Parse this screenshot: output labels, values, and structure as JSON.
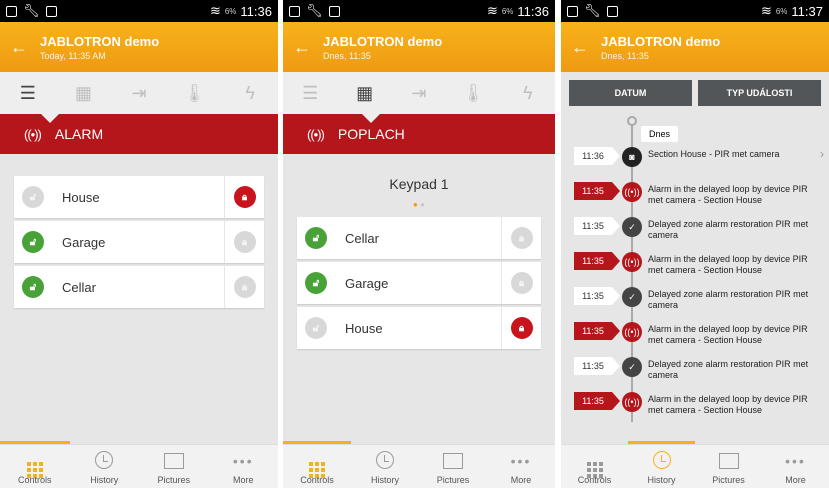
{
  "status": {
    "time1": "11:36",
    "time2": "11:36",
    "time3": "11:37",
    "battery": "6%"
  },
  "app": {
    "title": "JABLOTRON demo",
    "sub1": "Today, 11:35 AM",
    "sub2": "Dnes, 11:35",
    "sub3": "Dnes, 11:35"
  },
  "panel1": {
    "banner": "ALARM",
    "rows": [
      {
        "label": "House",
        "state": "grey",
        "right": "red"
      },
      {
        "label": "Garage",
        "state": "green",
        "right": "grey"
      },
      {
        "label": "Cellar",
        "state": "green",
        "right": "grey"
      }
    ]
  },
  "panel2": {
    "banner": "POPLACH",
    "keypad": "Keypad 1",
    "rows": [
      {
        "label": "Cellar",
        "state": "green",
        "right": "grey"
      },
      {
        "label": "Garage",
        "state": "green",
        "right": "grey"
      },
      {
        "label": "House",
        "state": "grey",
        "right": "red"
      }
    ]
  },
  "panel3": {
    "btn_date": "DATUM",
    "btn_type": "TYP UDÁLOSTI",
    "day": "Dnes",
    "events": [
      {
        "time": "11:36",
        "style": "w",
        "icon": "cam",
        "text": "Section House - PIR  met camera",
        "chev": true
      },
      {
        "time": "11:35",
        "style": "r",
        "icon": "alarm",
        "text": "Alarm in the delayed loop by device PIR  met camera - Section House"
      },
      {
        "time": "11:35",
        "style": "w",
        "icon": "ok",
        "text": "Delayed zone alarm restoration PIR  met camera"
      },
      {
        "time": "11:35",
        "style": "r",
        "icon": "alarm",
        "text": "Alarm in the delayed loop by device PIR  met camera - Section House"
      },
      {
        "time": "11:35",
        "style": "w",
        "icon": "ok",
        "text": "Delayed zone alarm restoration PIR  met camera"
      },
      {
        "time": "11:35",
        "style": "r",
        "icon": "alarm",
        "text": "Alarm in the delayed loop by device PIR  met camera - Section House"
      },
      {
        "time": "11:35",
        "style": "w",
        "icon": "ok",
        "text": "Delayed zone alarm restoration PIR  met camera"
      },
      {
        "time": "11:35",
        "style": "r",
        "icon": "alarm",
        "text": "Alarm in the delayed loop by device PIR  met camera - Section House"
      }
    ]
  },
  "tabs": {
    "controls": "Controls",
    "history": "History",
    "pictures": "Pictures",
    "more": "More"
  },
  "colors": {
    "accent": "#f2b21a",
    "alarm_red": "#b5161b",
    "green": "#49a237"
  }
}
